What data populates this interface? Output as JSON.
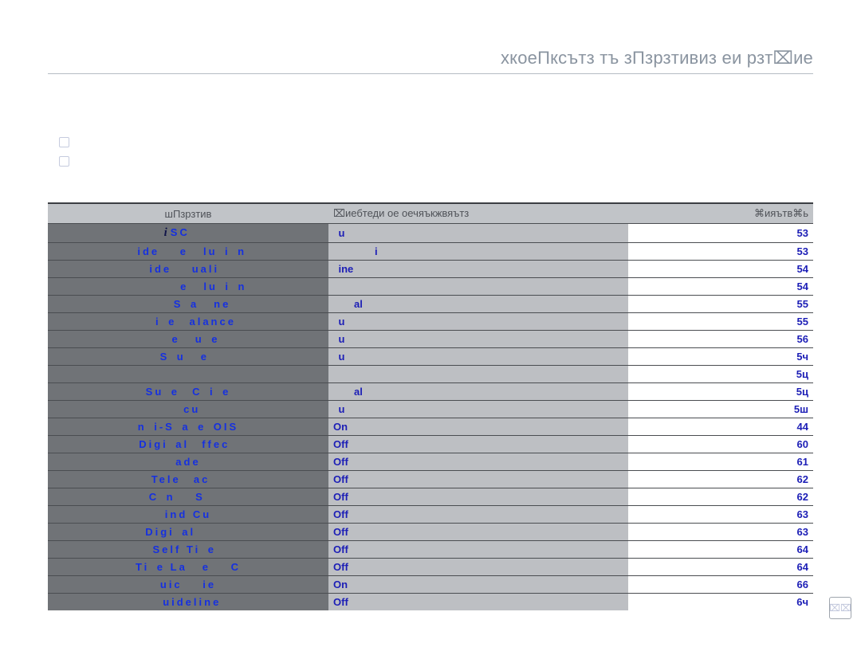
{
  "chapter_title": "хкоеПксътз тъ зПзрзтивиз еи рзт⌧ие",
  "page_title": "                 ",
  "sub_links": [
    "              ",
    "         "
  ],
  "section_header": "       ",
  "table": {
    "headers": {
      "item": "шПзрзтив",
      "default": "⌧иебтеди ое оечяъкжвяътз",
      "page": "⌘ияътв⌘ь"
    },
    "rows": [
      {
        "item": "SC   ",
        "iscene": true,
        "default": " u  ",
        "page": "53"
      },
      {
        "item": " ide   e  lu i n",
        "default": "        i",
        "page": "53"
      },
      {
        "item": " ide   uali  ",
        "default": " ine",
        "page": "54"
      },
      {
        "item": "       e  lu i n",
        "default": "         ",
        "page": "54"
      },
      {
        "item": "      S a  ne  ",
        "default": "    al",
        "page": "55"
      },
      {
        "item": "  i e  alance",
        "default": " u  ",
        "page": "55"
      },
      {
        "item": "  e  u e",
        "default": " u  ",
        "page": "56"
      },
      {
        "item": "S u  e ",
        "default": " u  ",
        "page": "5ч"
      },
      {
        "item": "  ",
        "default": " ",
        "page": "5ц"
      },
      {
        "item": "Su e  C i e",
        "default": "    al",
        "page": "5ц"
      },
      {
        "item": "  cu ",
        "default": " u  ",
        "page": "5ш"
      },
      {
        "item": " n i-S a e OIS ",
        "default": "On",
        "page": "44"
      },
      {
        "item": "Digi al  ffec ",
        "default": "Off",
        "page": "60"
      },
      {
        "item": " ade ",
        "default": "Off",
        "page": "61"
      },
      {
        "item": "Tele  ac  ",
        "default": "Off",
        "page": "62"
      },
      {
        "item": "C n   S   ",
        "default": "Off",
        "page": "62"
      },
      {
        "item": " ind Cu ",
        "default": "Off",
        "page": "63"
      },
      {
        "item": "Digi al     ",
        "default": "Off",
        "page": "63"
      },
      {
        "item": "Self Ti e ",
        "default": "Off",
        "page": "64"
      },
      {
        "item": "Ti e La  e   C",
        "default": "Off",
        "page": "64"
      },
      {
        "item": " uic   ie ",
        "default": "On",
        "page": "66"
      },
      {
        "item": " uideline",
        "default": "Off",
        "page": "6ч"
      }
    ]
  },
  "page_number": "⌧⌧"
}
